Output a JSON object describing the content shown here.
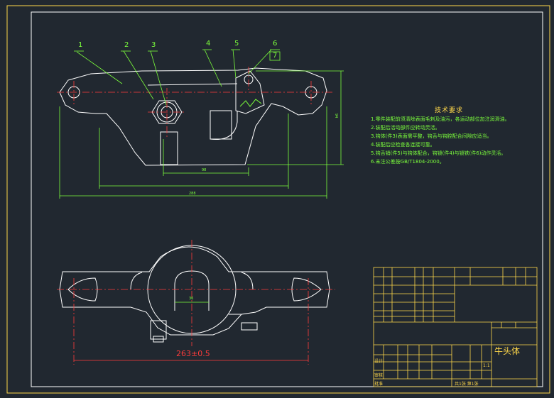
{
  "balloons": [
    "1",
    "2",
    "3",
    "4",
    "5",
    "6",
    "7"
  ],
  "dimensions": {
    "overall_bottom": "263±0.5",
    "width_28": "28",
    "width_36": "36",
    "dim_98": "98",
    "dim_288": "288",
    "dim_side": "94"
  },
  "notes": {
    "title": "技术要求",
    "lines": [
      "1.零件装配前须清除表面毛刺及油污，各运动部位加注润滑油。",
      "2.装配后活动部件应转动灵活。",
      "3.钩体(件3)表面需平整，钩舌与钩腔配合间隙应适当。",
      "4.装配后应检查各连接可靠。",
      "5.钩舌销(件5)与钩体配合，钩锁(件4)与锁铁(件6)动作灵活。",
      "6.未注公差按GB/T1804-2000。"
    ]
  },
  "title_block": {
    "name": "牛头体",
    "scale": "1:1",
    "sheet": "共1张 第1张",
    "designer": "设计",
    "checker": "审核",
    "approver": "批准"
  },
  "colors": {
    "background": "#212830",
    "outline": "#ffffff",
    "center": "#ff3b3b",
    "dimension": "#7cff3c",
    "titleblock": "#ffd84a"
  }
}
